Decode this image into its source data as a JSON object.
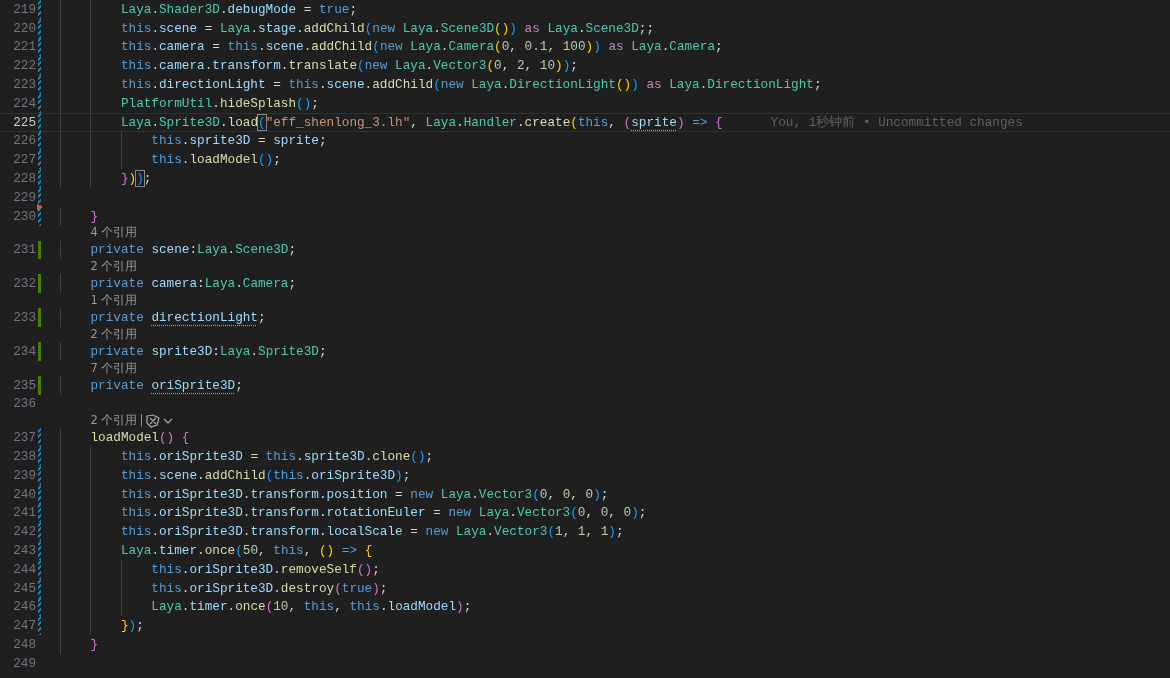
{
  "editor": {
    "lines": [
      {
        "kind": "code",
        "number": "219",
        "modified": true,
        "added": false,
        "deleted_above": false,
        "selected": false,
        "tokens": [
          {
            "text": "        Laya",
            "kind": "type"
          },
          {
            "text": ".",
            "kind": "p"
          },
          {
            "text": "Shader3D",
            "kind": "type"
          },
          {
            "text": ".",
            "kind": "p"
          },
          {
            "text": "debugMode",
            "kind": "prop"
          },
          {
            "text": " = ",
            "kind": "p"
          },
          {
            "text": "true",
            "kind": "kw"
          },
          {
            "text": ";",
            "kind": "p"
          }
        ]
      },
      {
        "kind": "code",
        "number": "220",
        "modified": true,
        "added": false,
        "deleted_above": false,
        "selected": false,
        "tokens": [
          {
            "text": "        this",
            "kind": "kw"
          },
          {
            "text": ".",
            "kind": "p"
          },
          {
            "text": "scene",
            "kind": "prop"
          },
          {
            "text": " = ",
            "kind": "p"
          },
          {
            "text": "Laya",
            "kind": "type"
          },
          {
            "text": ".",
            "kind": "p"
          },
          {
            "text": "stage",
            "kind": "prop"
          },
          {
            "text": ".",
            "kind": "p"
          },
          {
            "text": "addChild",
            "kind": "fn"
          },
          {
            "text": "(",
            "kind": "b3"
          },
          {
            "text": "new",
            "kind": "kw"
          },
          {
            "text": " Laya",
            "kind": "type"
          },
          {
            "text": ".",
            "kind": "p"
          },
          {
            "text": "Scene3D",
            "kind": "type"
          },
          {
            "text": "()",
            "kind": "b1"
          },
          {
            "text": ")",
            "kind": "b3"
          },
          {
            "text": " as",
            "kind": "ctrl"
          },
          {
            "text": " Laya",
            "kind": "type"
          },
          {
            "text": ".",
            "kind": "p"
          },
          {
            "text": "Scene3D",
            "kind": "type"
          },
          {
            "text": ";;",
            "kind": "p"
          }
        ]
      },
      {
        "kind": "code",
        "number": "221",
        "modified": true,
        "added": false,
        "deleted_above": false,
        "selected": false,
        "tokens": [
          {
            "text": "        this",
            "kind": "kw"
          },
          {
            "text": ".",
            "kind": "p"
          },
          {
            "text": "camera",
            "kind": "prop"
          },
          {
            "text": " = ",
            "kind": "p"
          },
          {
            "text": "this",
            "kind": "kw"
          },
          {
            "text": ".",
            "kind": "p"
          },
          {
            "text": "scene",
            "kind": "prop"
          },
          {
            "text": ".",
            "kind": "p"
          },
          {
            "text": "addChild",
            "kind": "fn"
          },
          {
            "text": "(",
            "kind": "b3"
          },
          {
            "text": "new",
            "kind": "kw"
          },
          {
            "text": " Laya",
            "kind": "type"
          },
          {
            "text": ".",
            "kind": "p"
          },
          {
            "text": "Camera",
            "kind": "type"
          },
          {
            "text": "(",
            "kind": "b1"
          },
          {
            "text": "0",
            "kind": "num"
          },
          {
            "text": ", ",
            "kind": "p"
          },
          {
            "text": "0.1",
            "kind": "num"
          },
          {
            "text": ", ",
            "kind": "p"
          },
          {
            "text": "100",
            "kind": "num"
          },
          {
            "text": ")",
            "kind": "b1"
          },
          {
            "text": ")",
            "kind": "b3"
          },
          {
            "text": " as",
            "kind": "ctrl"
          },
          {
            "text": " Laya",
            "kind": "type"
          },
          {
            "text": ".",
            "kind": "p"
          },
          {
            "text": "Camera",
            "kind": "type"
          },
          {
            "text": ";",
            "kind": "p"
          }
        ]
      },
      {
        "kind": "code",
        "number": "222",
        "modified": true,
        "added": false,
        "deleted_above": false,
        "selected": false,
        "tokens": [
          {
            "text": "        this",
            "kind": "kw"
          },
          {
            "text": ".",
            "kind": "p"
          },
          {
            "text": "camera",
            "kind": "prop"
          },
          {
            "text": ".",
            "kind": "p"
          },
          {
            "text": "transform",
            "kind": "prop"
          },
          {
            "text": ".",
            "kind": "p"
          },
          {
            "text": "translate",
            "kind": "fn"
          },
          {
            "text": "(",
            "kind": "b3"
          },
          {
            "text": "new",
            "kind": "kw"
          },
          {
            "text": " Laya",
            "kind": "type"
          },
          {
            "text": ".",
            "kind": "p"
          },
          {
            "text": "Vector3",
            "kind": "type"
          },
          {
            "text": "(",
            "kind": "b1"
          },
          {
            "text": "0",
            "kind": "num"
          },
          {
            "text": ", ",
            "kind": "p"
          },
          {
            "text": "2",
            "kind": "num"
          },
          {
            "text": ", ",
            "kind": "p"
          },
          {
            "text": "10",
            "kind": "num"
          },
          {
            "text": ")",
            "kind": "b1"
          },
          {
            "text": ")",
            "kind": "b3"
          },
          {
            "text": ";",
            "kind": "p"
          }
        ]
      },
      {
        "kind": "code",
        "number": "223",
        "modified": true,
        "added": false,
        "deleted_above": false,
        "selected": false,
        "tokens": [
          {
            "text": "        this",
            "kind": "kw"
          },
          {
            "text": ".",
            "kind": "p"
          },
          {
            "text": "directionLight",
            "kind": "prop"
          },
          {
            "text": " = ",
            "kind": "p"
          },
          {
            "text": "this",
            "kind": "kw"
          },
          {
            "text": ".",
            "kind": "p"
          },
          {
            "text": "scene",
            "kind": "prop"
          },
          {
            "text": ".",
            "kind": "p"
          },
          {
            "text": "addChild",
            "kind": "fn"
          },
          {
            "text": "(",
            "kind": "b3"
          },
          {
            "text": "new",
            "kind": "kw"
          },
          {
            "text": " Laya",
            "kind": "type"
          },
          {
            "text": ".",
            "kind": "p"
          },
          {
            "text": "DirectionLight",
            "kind": "type"
          },
          {
            "text": "()",
            "kind": "b1"
          },
          {
            "text": ")",
            "kind": "b3"
          },
          {
            "text": " as",
            "kind": "ctrl"
          },
          {
            "text": " Laya",
            "kind": "type"
          },
          {
            "text": ".",
            "kind": "p"
          },
          {
            "text": "DirectionLight",
            "kind": "type"
          },
          {
            "text": ";",
            "kind": "p"
          }
        ]
      },
      {
        "kind": "code",
        "number": "224",
        "modified": true,
        "added": false,
        "deleted_above": false,
        "selected": false,
        "tokens": [
          {
            "text": "        PlatformUtil",
            "kind": "type"
          },
          {
            "text": ".",
            "kind": "p"
          },
          {
            "text": "hideSplash",
            "kind": "fn"
          },
          {
            "text": "()",
            "kind": "b3"
          },
          {
            "text": ";",
            "kind": "p"
          }
        ]
      },
      {
        "kind": "code",
        "number": "225",
        "modified": true,
        "added": false,
        "deleted_above": false,
        "selected": true,
        "blame": "You, 1秒钟前 • Uncommitted changes",
        "tokens": [
          {
            "text": "        Laya",
            "kind": "type"
          },
          {
            "text": ".",
            "kind": "p"
          },
          {
            "text": "Sprite3D",
            "kind": "type"
          },
          {
            "text": ".",
            "kind": "p"
          },
          {
            "text": "load",
            "kind": "fn"
          },
          {
            "text": "(",
            "kind": "b3_match"
          },
          {
            "text": "\"eff_shenlong_3.lh\"",
            "kind": "str"
          },
          {
            "text": ", ",
            "kind": "p"
          },
          {
            "text": "Laya",
            "kind": "type"
          },
          {
            "text": ".",
            "kind": "p"
          },
          {
            "text": "Handler",
            "kind": "type"
          },
          {
            "text": ".",
            "kind": "p"
          },
          {
            "text": "create",
            "kind": "fn"
          },
          {
            "text": "(",
            "kind": "b1"
          },
          {
            "text": "this",
            "kind": "kw"
          },
          {
            "text": ", ",
            "kind": "p"
          },
          {
            "text": "(",
            "kind": "b2"
          },
          {
            "text": "sprite",
            "kind": "prop_hint"
          },
          {
            "text": ")",
            "kind": "b2"
          },
          {
            "text": " => ",
            "kind": "kw"
          },
          {
            "text": "{",
            "kind": "b2"
          }
        ]
      },
      {
        "kind": "code",
        "number": "226",
        "modified": true,
        "added": false,
        "deleted_above": false,
        "selected": false,
        "tokens": [
          {
            "text": "            this",
            "kind": "kw"
          },
          {
            "text": ".",
            "kind": "p"
          },
          {
            "text": "sprite3D",
            "kind": "prop"
          },
          {
            "text": " = ",
            "kind": "p"
          },
          {
            "text": "sprite",
            "kind": "prop"
          },
          {
            "text": ";",
            "kind": "p"
          }
        ]
      },
      {
        "kind": "code",
        "number": "227",
        "modified": true,
        "added": false,
        "deleted_above": false,
        "selected": false,
        "tokens": [
          {
            "text": "            this",
            "kind": "kw"
          },
          {
            "text": ".",
            "kind": "p"
          },
          {
            "text": "loadModel",
            "kind": "fn"
          },
          {
            "text": "()",
            "kind": "b3"
          },
          {
            "text": ";",
            "kind": "p"
          }
        ]
      },
      {
        "kind": "code",
        "number": "228",
        "modified": true,
        "added": false,
        "deleted_above": false,
        "selected": false,
        "tokens": [
          {
            "text": "        }",
            "kind": "b2"
          },
          {
            "text": ")",
            "kind": "b1"
          },
          {
            "text": ")",
            "kind": "b3_match"
          },
          {
            "text": ";",
            "kind": "p"
          }
        ]
      },
      {
        "kind": "code",
        "number": "229",
        "modified": true,
        "added": false,
        "deleted_above": false,
        "selected": false
      },
      {
        "kind": "code",
        "number": "230",
        "modified": true,
        "added": false,
        "deleted_above": true,
        "selected": false,
        "tokens": [
          {
            "text": "    }",
            "kind": "b2"
          }
        ]
      },
      {
        "kind": "codelens",
        "label": "4 个引用"
      },
      {
        "kind": "code",
        "number": "231",
        "modified": false,
        "added": true,
        "deleted_above": false,
        "selected": false,
        "tokens": [
          {
            "text": "    private",
            "kind": "kw"
          },
          {
            "text": " scene",
            "kind": "prop"
          },
          {
            "text": ":",
            "kind": "p"
          },
          {
            "text": "Laya",
            "kind": "type"
          },
          {
            "text": ".",
            "kind": "p"
          },
          {
            "text": "Scene3D",
            "kind": "type"
          },
          {
            "text": ";",
            "kind": "p"
          }
        ]
      },
      {
        "kind": "codelens",
        "label": "2 个引用"
      },
      {
        "kind": "code",
        "number": "232",
        "modified": false,
        "added": true,
        "deleted_above": false,
        "selected": false,
        "tokens": [
          {
            "text": "    private",
            "kind": "kw"
          },
          {
            "text": " camera",
            "kind": "prop"
          },
          {
            "text": ":",
            "kind": "p"
          },
          {
            "text": "Laya",
            "kind": "type"
          },
          {
            "text": ".",
            "kind": "p"
          },
          {
            "text": "Camera",
            "kind": "type"
          },
          {
            "text": ";",
            "kind": "p"
          }
        ]
      },
      {
        "kind": "codelens",
        "label": "1 个引用"
      },
      {
        "kind": "code",
        "number": "233",
        "modified": false,
        "added": true,
        "deleted_above": false,
        "selected": false,
        "tokens": [
          {
            "text": "    private ",
            "kind": "kw"
          },
          {
            "text": "directionLight",
            "kind": "prop_hint"
          },
          {
            "text": ";",
            "kind": "p"
          }
        ]
      },
      {
        "kind": "codelens",
        "label": "2 个引用"
      },
      {
        "kind": "code",
        "number": "234",
        "modified": false,
        "added": true,
        "deleted_above": false,
        "selected": false,
        "tokens": [
          {
            "text": "    private",
            "kind": "kw"
          },
          {
            "text": " sprite3D",
            "kind": "prop"
          },
          {
            "text": ":",
            "kind": "p"
          },
          {
            "text": "Laya",
            "kind": "type"
          },
          {
            "text": ".",
            "kind": "p"
          },
          {
            "text": "Sprite3D",
            "kind": "type"
          },
          {
            "text": ";",
            "kind": "p"
          }
        ]
      },
      {
        "kind": "codelens",
        "label": "7 个引用"
      },
      {
        "kind": "code",
        "number": "235",
        "modified": false,
        "added": true,
        "deleted_above": false,
        "selected": false,
        "tokens": [
          {
            "text": "    private ",
            "kind": "kw"
          },
          {
            "text": "oriSprite3D",
            "kind": "prop_hint"
          },
          {
            "text": ";",
            "kind": "p"
          }
        ]
      },
      {
        "kind": "code",
        "number": "236",
        "modified": false,
        "added": false,
        "deleted_above": false,
        "selected": false
      },
      {
        "kind": "codelens",
        "label": "2 个引用",
        "separator": "|",
        "actions_menu": true
      },
      {
        "kind": "code",
        "number": "237",
        "modified": true,
        "added": false,
        "deleted_above": false,
        "selected": false,
        "tokens": [
          {
            "text": "    loadModel",
            "kind": "fn"
          },
          {
            "text": "()",
            "kind": "b2"
          },
          {
            "text": " {",
            "kind": "b2"
          }
        ]
      },
      {
        "kind": "code",
        "number": "238",
        "modified": true,
        "added": false,
        "deleted_above": false,
        "selected": false,
        "tokens": [
          {
            "text": "        this",
            "kind": "kw"
          },
          {
            "text": ".",
            "kind": "p"
          },
          {
            "text": "oriSprite3D",
            "kind": "prop"
          },
          {
            "text": " = ",
            "kind": "p"
          },
          {
            "text": "this",
            "kind": "kw"
          },
          {
            "text": ".",
            "kind": "p"
          },
          {
            "text": "sprite3D",
            "kind": "prop"
          },
          {
            "text": ".",
            "kind": "p"
          },
          {
            "text": "clone",
            "kind": "fn"
          },
          {
            "text": "()",
            "kind": "b3"
          },
          {
            "text": ";",
            "kind": "p"
          }
        ]
      },
      {
        "kind": "code",
        "number": "239",
        "modified": true,
        "added": false,
        "deleted_above": false,
        "selected": false,
        "tokens": [
          {
            "text": "        this",
            "kind": "kw"
          },
          {
            "text": ".",
            "kind": "p"
          },
          {
            "text": "scene",
            "kind": "prop"
          },
          {
            "text": ".",
            "kind": "p"
          },
          {
            "text": "addChild",
            "kind": "fn"
          },
          {
            "text": "(",
            "kind": "b3"
          },
          {
            "text": "this",
            "kind": "kw"
          },
          {
            "text": ".",
            "kind": "p"
          },
          {
            "text": "oriSprite3D",
            "kind": "prop"
          },
          {
            "text": ")",
            "kind": "b3"
          },
          {
            "text": ";",
            "kind": "p"
          }
        ]
      },
      {
        "kind": "code",
        "number": "240",
        "modified": true,
        "added": false,
        "deleted_above": false,
        "selected": false,
        "tokens": [
          {
            "text": "        this",
            "kind": "kw"
          },
          {
            "text": ".",
            "kind": "p"
          },
          {
            "text": "oriSprite3D",
            "kind": "prop"
          },
          {
            "text": ".",
            "kind": "p"
          },
          {
            "text": "transform",
            "kind": "prop"
          },
          {
            "text": ".",
            "kind": "p"
          },
          {
            "text": "position",
            "kind": "prop"
          },
          {
            "text": " = ",
            "kind": "p"
          },
          {
            "text": "new",
            "kind": "kw"
          },
          {
            "text": " Laya",
            "kind": "type"
          },
          {
            "text": ".",
            "kind": "p"
          },
          {
            "text": "Vector3",
            "kind": "type"
          },
          {
            "text": "(",
            "kind": "b3"
          },
          {
            "text": "0",
            "kind": "num"
          },
          {
            "text": ", ",
            "kind": "p"
          },
          {
            "text": "0",
            "kind": "num"
          },
          {
            "text": ", ",
            "kind": "p"
          },
          {
            "text": "0",
            "kind": "num"
          },
          {
            "text": ")",
            "kind": "b3"
          },
          {
            "text": ";",
            "kind": "p"
          }
        ]
      },
      {
        "kind": "code",
        "number": "241",
        "modified": true,
        "added": false,
        "deleted_above": false,
        "selected": false,
        "tokens": [
          {
            "text": "        this",
            "kind": "kw"
          },
          {
            "text": ".",
            "kind": "p"
          },
          {
            "text": "oriSprite3D",
            "kind": "prop"
          },
          {
            "text": ".",
            "kind": "p"
          },
          {
            "text": "transform",
            "kind": "prop"
          },
          {
            "text": ".",
            "kind": "p"
          },
          {
            "text": "rotationEuler",
            "kind": "prop"
          },
          {
            "text": " = ",
            "kind": "p"
          },
          {
            "text": "new",
            "kind": "kw"
          },
          {
            "text": " Laya",
            "kind": "type"
          },
          {
            "text": ".",
            "kind": "p"
          },
          {
            "text": "Vector3",
            "kind": "type"
          },
          {
            "text": "(",
            "kind": "b3"
          },
          {
            "text": "0",
            "kind": "num"
          },
          {
            "text": ", ",
            "kind": "p"
          },
          {
            "text": "0",
            "kind": "num"
          },
          {
            "text": ", ",
            "kind": "p"
          },
          {
            "text": "0",
            "kind": "num"
          },
          {
            "text": ")",
            "kind": "b3"
          },
          {
            "text": ";",
            "kind": "p"
          }
        ]
      },
      {
        "kind": "code",
        "number": "242",
        "modified": true,
        "added": false,
        "deleted_above": false,
        "selected": false,
        "tokens": [
          {
            "text": "        this",
            "kind": "kw"
          },
          {
            "text": ".",
            "kind": "p"
          },
          {
            "text": "oriSprite3D",
            "kind": "prop"
          },
          {
            "text": ".",
            "kind": "p"
          },
          {
            "text": "transform",
            "kind": "prop"
          },
          {
            "text": ".",
            "kind": "p"
          },
          {
            "text": "localScale",
            "kind": "prop"
          },
          {
            "text": " = ",
            "kind": "p"
          },
          {
            "text": "new",
            "kind": "kw"
          },
          {
            "text": " Laya",
            "kind": "type"
          },
          {
            "text": ".",
            "kind": "p"
          },
          {
            "text": "Vector3",
            "kind": "type"
          },
          {
            "text": "(",
            "kind": "b3"
          },
          {
            "text": "1",
            "kind": "num"
          },
          {
            "text": ", ",
            "kind": "p"
          },
          {
            "text": "1",
            "kind": "num"
          },
          {
            "text": ", ",
            "kind": "p"
          },
          {
            "text": "1",
            "kind": "num"
          },
          {
            "text": ")",
            "kind": "b3"
          },
          {
            "text": ";",
            "kind": "p"
          }
        ]
      },
      {
        "kind": "code",
        "number": "243",
        "modified": true,
        "added": false,
        "deleted_above": false,
        "selected": false,
        "tokens": [
          {
            "text": "        Laya",
            "kind": "type"
          },
          {
            "text": ".",
            "kind": "p"
          },
          {
            "text": "timer",
            "kind": "prop"
          },
          {
            "text": ".",
            "kind": "p"
          },
          {
            "text": "once",
            "kind": "fn"
          },
          {
            "text": "(",
            "kind": "b3"
          },
          {
            "text": "50",
            "kind": "num"
          },
          {
            "text": ", ",
            "kind": "p"
          },
          {
            "text": "this",
            "kind": "kw"
          },
          {
            "text": ", ",
            "kind": "p"
          },
          {
            "text": "()",
            "kind": "b1"
          },
          {
            "text": " => ",
            "kind": "kw"
          },
          {
            "text": "{",
            "kind": "b1"
          }
        ]
      },
      {
        "kind": "code",
        "number": "244",
        "modified": true,
        "added": false,
        "deleted_above": false,
        "selected": false,
        "tokens": [
          {
            "text": "            this",
            "kind": "kw"
          },
          {
            "text": ".",
            "kind": "p"
          },
          {
            "text": "oriSprite3D",
            "kind": "prop"
          },
          {
            "text": ".",
            "kind": "p"
          },
          {
            "text": "removeSelf",
            "kind": "fn"
          },
          {
            "text": "()",
            "kind": "b2"
          },
          {
            "text": ";",
            "kind": "p"
          }
        ]
      },
      {
        "kind": "code",
        "number": "245",
        "modified": true,
        "added": false,
        "deleted_above": false,
        "selected": false,
        "tokens": [
          {
            "text": "            this",
            "kind": "kw"
          },
          {
            "text": ".",
            "kind": "p"
          },
          {
            "text": "oriSprite3D",
            "kind": "prop"
          },
          {
            "text": ".",
            "kind": "p"
          },
          {
            "text": "destroy",
            "kind": "fn"
          },
          {
            "text": "(",
            "kind": "b2"
          },
          {
            "text": "true",
            "kind": "kw"
          },
          {
            "text": ")",
            "kind": "b2"
          },
          {
            "text": ";",
            "kind": "p"
          }
        ]
      },
      {
        "kind": "code",
        "number": "246",
        "modified": true,
        "added": false,
        "deleted_above": false,
        "selected": false,
        "tokens": [
          {
            "text": "            Laya",
            "kind": "type"
          },
          {
            "text": ".",
            "kind": "p"
          },
          {
            "text": "timer",
            "kind": "prop"
          },
          {
            "text": ".",
            "kind": "p"
          },
          {
            "text": "once",
            "kind": "fn"
          },
          {
            "text": "(",
            "kind": "b2"
          },
          {
            "text": "10",
            "kind": "num"
          },
          {
            "text": ", ",
            "kind": "p"
          },
          {
            "text": "this",
            "kind": "kw"
          },
          {
            "text": ", ",
            "kind": "p"
          },
          {
            "text": "this",
            "kind": "kw"
          },
          {
            "text": ".",
            "kind": "p"
          },
          {
            "text": "loadModel",
            "kind": "prop"
          },
          {
            "text": ")",
            "kind": "b2"
          },
          {
            "text": ";",
            "kind": "p"
          }
        ]
      },
      {
        "kind": "code",
        "number": "247",
        "modified": true,
        "added": false,
        "deleted_above": false,
        "selected": false,
        "tokens": [
          {
            "text": "        }",
            "kind": "b1"
          },
          {
            "text": ")",
            "kind": "b3"
          },
          {
            "text": ";",
            "kind": "p"
          }
        ]
      },
      {
        "kind": "code",
        "number": "248",
        "modified": false,
        "added": false,
        "deleted_above": false,
        "selected": false,
        "tokens": [
          {
            "text": "    }",
            "kind": "b2"
          }
        ]
      },
      {
        "kind": "code",
        "number": "249",
        "modified": false,
        "added": false,
        "deleted_above": false,
        "selected": false
      }
    ]
  }
}
